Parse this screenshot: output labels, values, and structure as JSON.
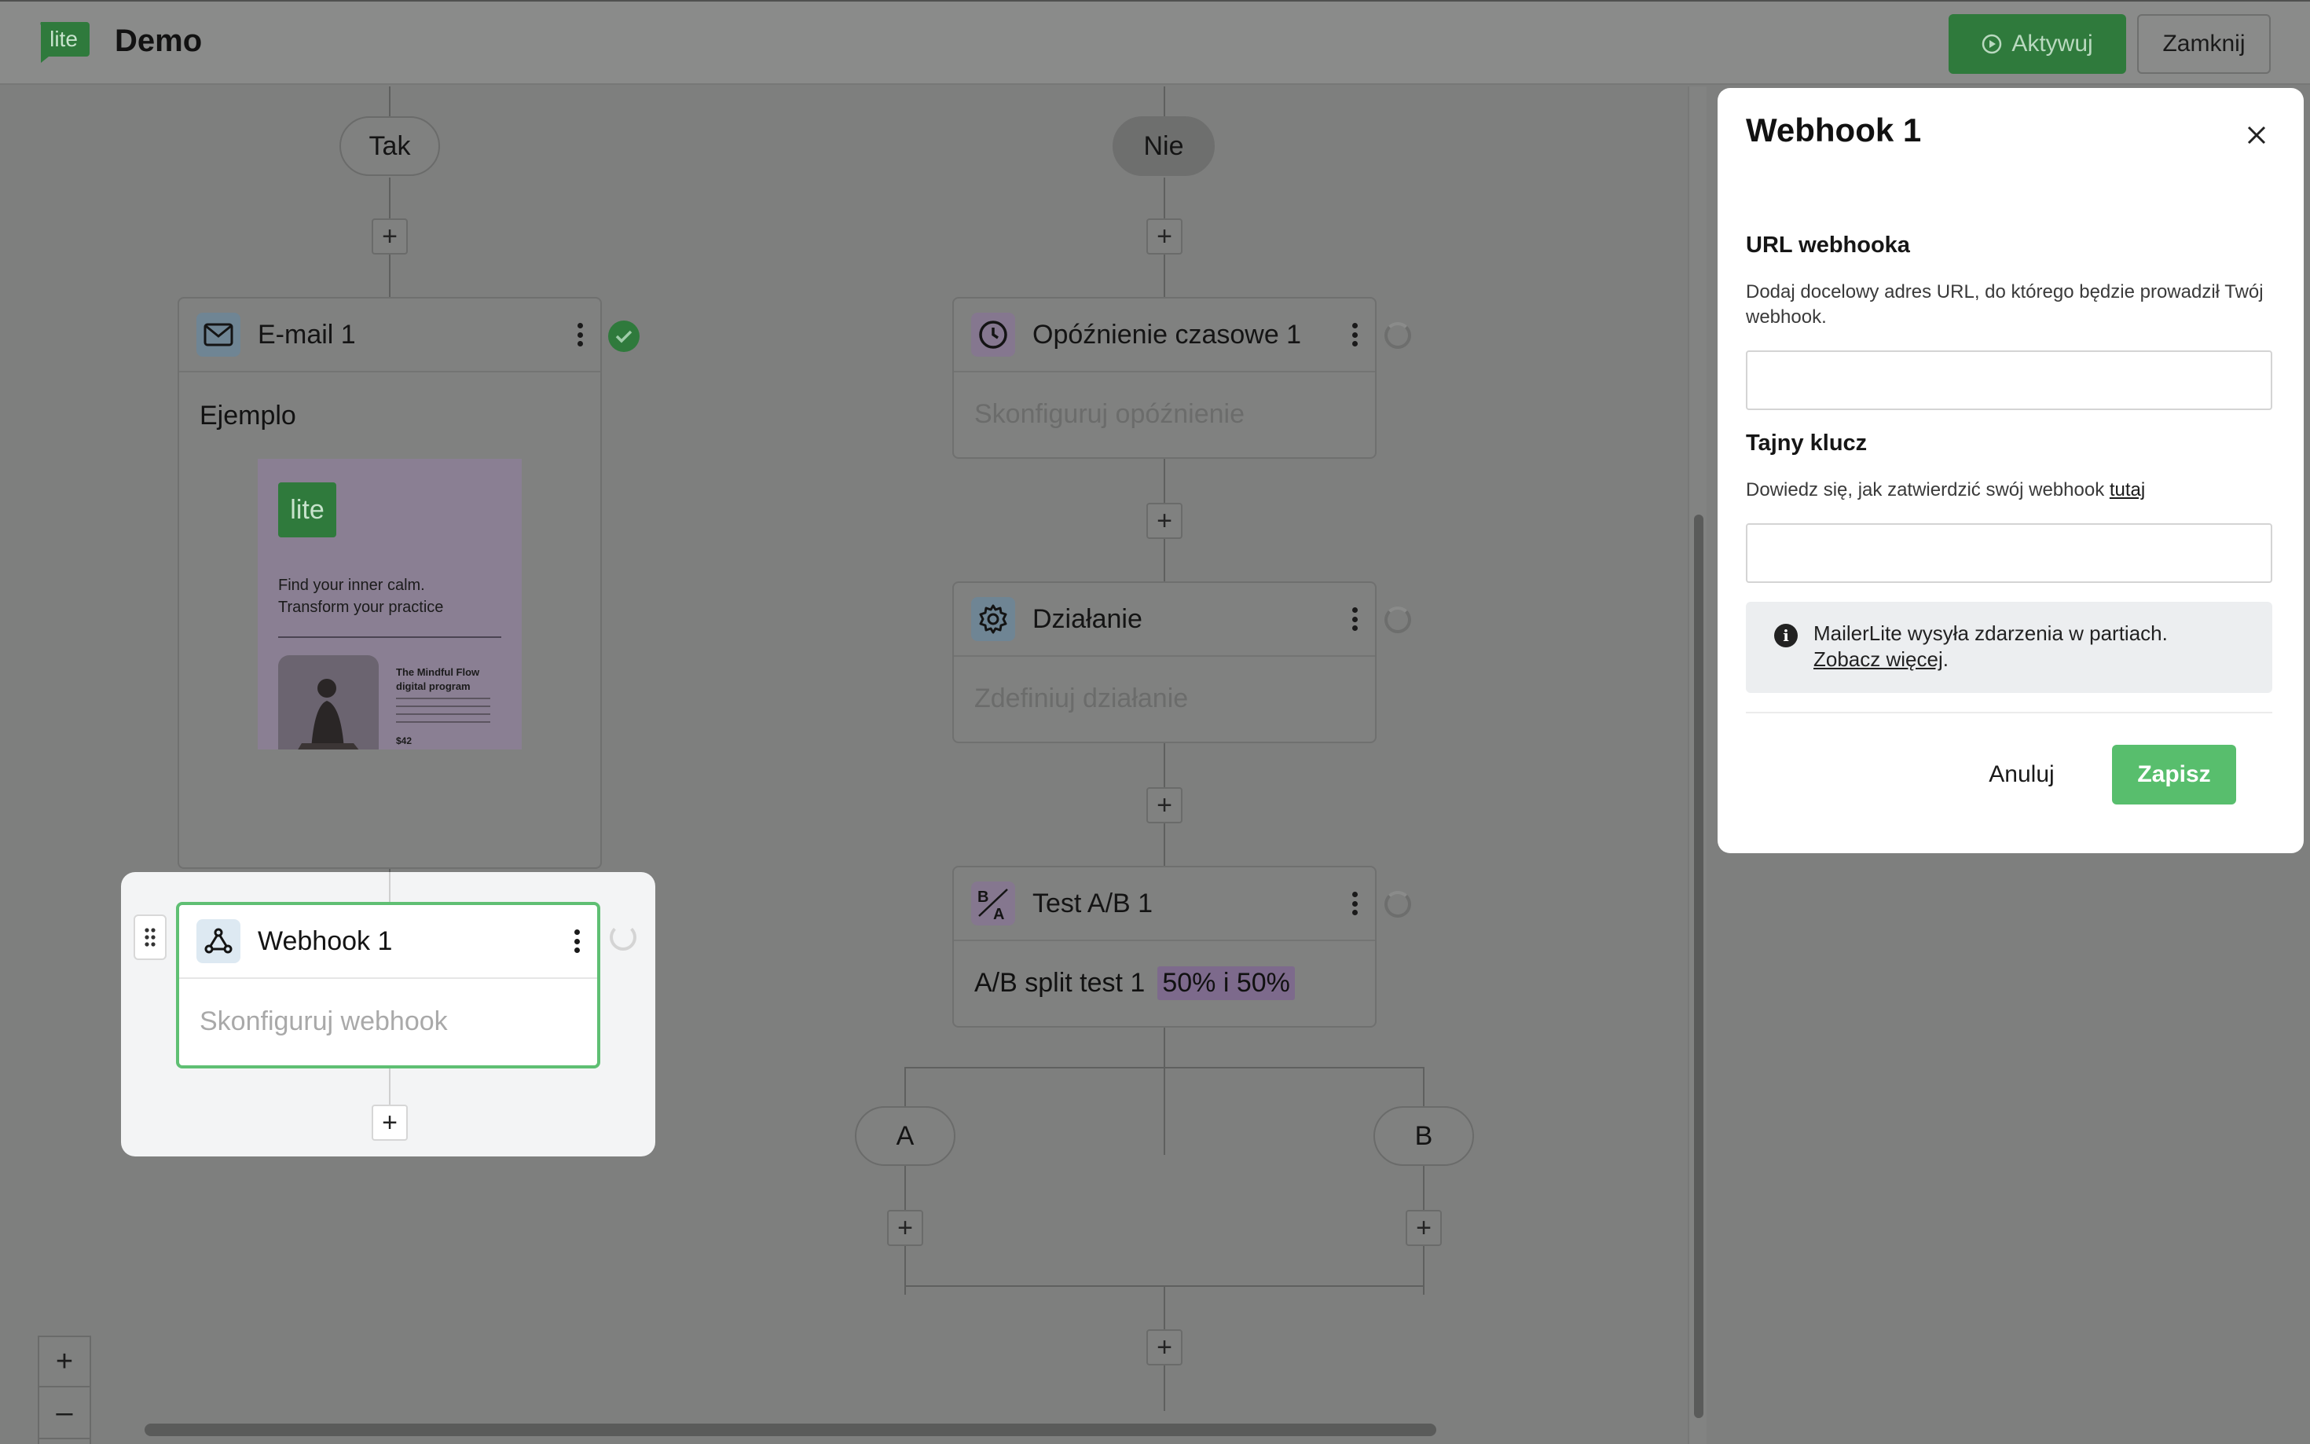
{
  "header": {
    "logo_text": "lite",
    "title": "Demo",
    "activate_label": "Aktywuj",
    "close_label": "Zamknij"
  },
  "canvas": {
    "branch_yes": "Tak",
    "branch_no": "Nie",
    "plus_label": "+",
    "email_node": {
      "title": "E-mail 1",
      "subject": "Ejemplo",
      "preview": {
        "logo": "lite",
        "headline_1": "Find your inner calm.",
        "headline_2": "Transform your practice",
        "product_title_1": "The Mindful Flow",
        "product_title_2": "digital program",
        "price": "$42"
      }
    },
    "webhook_node": {
      "title": "Webhook 1",
      "body": "Skonfiguruj webhook"
    },
    "delay_node": {
      "title": "Opóźnienie czasowe 1",
      "body": "Skonfiguruj opóźnienie"
    },
    "action_node": {
      "title": "Działanie",
      "body": "Zdefiniuj działanie"
    },
    "ab_node": {
      "title": "Test A/B 1",
      "body": "A/B split test 1",
      "split": "50% i 50%"
    },
    "branch_a": "A",
    "branch_b": "B",
    "zoom_in": "+",
    "zoom_out": "–"
  },
  "panel": {
    "title": "Webhook 1",
    "url_label": "URL webhooka",
    "url_help": "Dodaj docelowy adres URL, do którego będzie prowadził Twój webhook.",
    "url_value": "",
    "secret_label": "Tajny klucz",
    "secret_help": "Dowiedz się, jak zatwierdzić swój webhook",
    "secret_help_link": "tutaj",
    "secret_value": "",
    "info_text": "MailerLite wysyła zdarzenia w partiach.",
    "info_link": "Zobacz więcej",
    "cancel_label": "Anuluj",
    "save_label": "Zapisz"
  },
  "colors": {
    "brand_green": "#2f7a3c",
    "save_green": "#58be6d",
    "active_border": "#5fbf73"
  }
}
